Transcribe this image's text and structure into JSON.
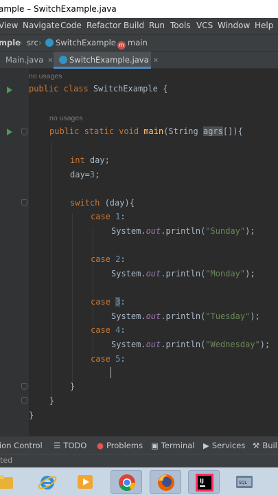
{
  "window": {
    "title": "ample – SwitchExample.java"
  },
  "menu": [
    "View",
    "Navigate",
    "Code",
    "Refactor",
    "Build",
    "Run",
    "Tools",
    "VCS",
    "Window",
    "Help"
  ],
  "breadcrumb": {
    "project": "mple",
    "folder": "src",
    "class": "SwitchExample",
    "method": "main"
  },
  "tabs": [
    {
      "label": "Main.java",
      "active": false
    },
    {
      "label": "SwitchExample.java",
      "active": true
    }
  ],
  "editor": {
    "hint_class": "no usages",
    "hint_method": "no usages",
    "line_class": {
      "kw": "public class ",
      "name": "SwitchExample {"
    },
    "line_main": {
      "kw": "public static void ",
      "fn": "main",
      "pre": "(String ",
      "arg": "agrs",
      "post": "[]){"
    },
    "line_decl": {
      "kw": "int",
      "rest": " day;"
    },
    "line_assign": {
      "pre": "day=",
      "num": "3",
      "end": ";"
    },
    "line_switch": {
      "kw": "switch",
      "rest": " (day){"
    },
    "cases": [
      {
        "kw": "case ",
        "num": "1",
        "end": ":",
        "pre": "System.",
        "fld": "out",
        "call": ".println(",
        "str": "\"Sunday\"",
        "close": ");"
      },
      {
        "kw": "case ",
        "num": "2",
        "end": ":",
        "pre": "System.",
        "fld": "out",
        "call": ".println(",
        "str": "\"Monday\"",
        "close": ");"
      },
      {
        "kw": "case ",
        "num": "3",
        "end": ":",
        "pre": "System.",
        "fld": "out",
        "call": ".println(",
        "str": "\"Tuesday\"",
        "close": ");"
      },
      {
        "kw": "case ",
        "num": "4",
        "end": ":",
        "pre": "System.",
        "fld": "out",
        "call": ".println(",
        "str": "\"Wednesday\"",
        "close": ");"
      }
    ],
    "case5": {
      "kw": "case ",
      "num": "5",
      "end": ":"
    },
    "brace": "}"
  },
  "toolwindows": [
    "ion Control",
    "TODO",
    "Problems",
    "Terminal",
    "Services",
    "Buil"
  ],
  "status": {
    "text": "ted"
  },
  "colors": {
    "editor_bg": "#2b2b2b",
    "keyword": "#cc7832",
    "string": "#6a8759",
    "number": "#6897bb",
    "field": "#9876aa",
    "method": "#ffc66d",
    "accent": "#4a88c7"
  },
  "taskbar": [
    "explorer-icon",
    "ie-icon",
    "media-player-icon",
    "chrome-icon",
    "firefox-icon",
    "intellij-icon",
    "sql-icon"
  ]
}
